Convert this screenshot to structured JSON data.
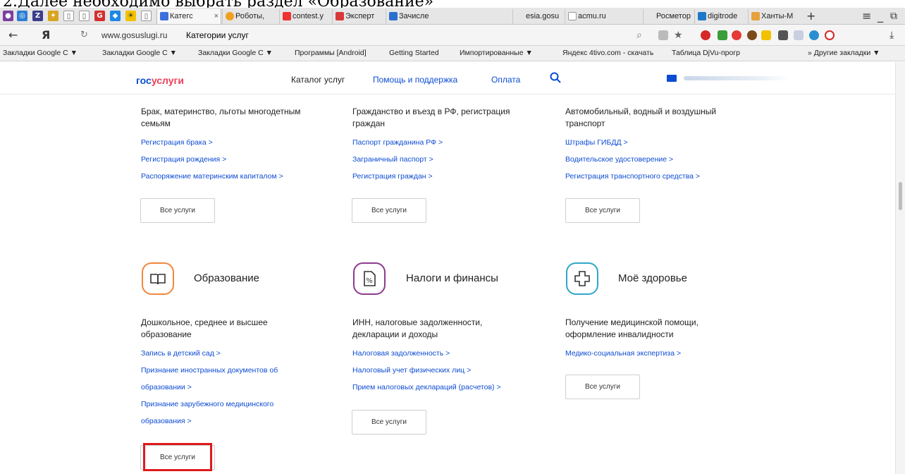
{
  "caption": "2.Далее необходимо выбрать раздел «Образование»",
  "tabs": {
    "items": [
      {
        "label": "Категс",
        "color": "#3d6fdc"
      },
      {
        "label": "Роботы,",
        "color": "#f0a020"
      },
      {
        "label": "contest.y",
        "color": "#ee3333"
      },
      {
        "label": "Эксперт",
        "color": "#d9383a"
      },
      {
        "label": "Зачисле",
        "color": "#2a6fcf"
      },
      {
        "label": "esia.gosu",
        "color": "#8fa6c8"
      },
      {
        "label": "acmu.ru",
        "color": "#888888"
      },
      {
        "label": "Росметор",
        "color": "#aaaaaa"
      },
      {
        "label": "digitrode",
        "color": "#1e78c8"
      },
      {
        "label": "Ханты-М",
        "color": "#e6a23c"
      }
    ],
    "close_glyph": "×",
    "new_tab_glyph": "+",
    "menu_glyph": "≡",
    "minimize_glyph": "_",
    "restore_glyph": "⧉"
  },
  "navbar": {
    "back_glyph": "←",
    "yandex_glyph": "Я",
    "reload_glyph": "↻",
    "host": "www.gosuslugi.ru",
    "title": "Категории услуг",
    "search_glyph": "⌕",
    "star_glyph": "★",
    "download_glyph": "⤓"
  },
  "bookmarks": {
    "items": [
      "Закладки Google С ▼",
      "Закладки Google С ▼",
      "Закладки Google С ▼",
      "Программы [Android]",
      "Getting Started",
      "Импортированные ▼",
      "Яндекс",
      "4tivo.com - скачать",
      "Таблица DjVu-прогр",
      "» Другие закладки ▼"
    ]
  },
  "header": {
    "logo_part1": "гос",
    "logo_part2": "услуги",
    "catalog": "Каталог услуг",
    "help": "Помощь и поддержка",
    "payment": "Оплата",
    "search_icon": "search-icon",
    "mail_icon": "mail-icon"
  },
  "top_categories": [
    {
      "desc": "Брак, материнство, льготы многодетным семьям",
      "links": [
        "Регистрация брака >",
        "Регистрация рождения >",
        "Распоряжение материнским капиталом >"
      ],
      "button": "Все услуги"
    },
    {
      "desc": "Гражданство и въезд в РФ, регистрация граждан",
      "links": [
        "Паспорт гражданина РФ >",
        "Заграничный паспорт >",
        "Регистрация граждан >"
      ],
      "button": "Все услуги"
    },
    {
      "desc": "Автомобильный, водный и воздушный транспорт",
      "links": [
        "Штрафы ГИБДД >",
        "Водительское удостоверение >",
        "Регистрация транспортного средства >"
      ],
      "button": "Все услуги"
    }
  ],
  "bottom_categories": [
    {
      "title": "Образование",
      "icon": "book-icon",
      "color": "#f0883e",
      "desc": "Дошкольное, среднее и высшее образование",
      "links": [
        "Запись в детский сад >",
        "Признание иностранных документов об",
        "образовании >",
        "Признание зарубежного медицинского",
        "образования >"
      ],
      "button": "Все услуги"
    },
    {
      "title": "Налоги и финансы",
      "icon": "tax-document-icon",
      "color": "#8e3a8e",
      "desc": "ИНН, налоговые задолженности, декларации и доходы",
      "links": [
        "Налоговая задолженность >",
        "Налоговый учет физических лиц >",
        "Прием налоговых деклараций (расчетов) >"
      ],
      "button": "Все услуги"
    },
    {
      "title": "Моё здоровье",
      "icon": "medical-cross-icon",
      "color": "#2fa7c8",
      "desc": "Получение медицинской помощи, оформление инвалидности",
      "links": [
        "Медико-социальная экспертиза >"
      ],
      "button": "Все услуги"
    }
  ],
  "colors": {
    "brand_blue": "#0d4cd3",
    "brand_red": "#ee3f58",
    "highlight": "#e0191b"
  }
}
